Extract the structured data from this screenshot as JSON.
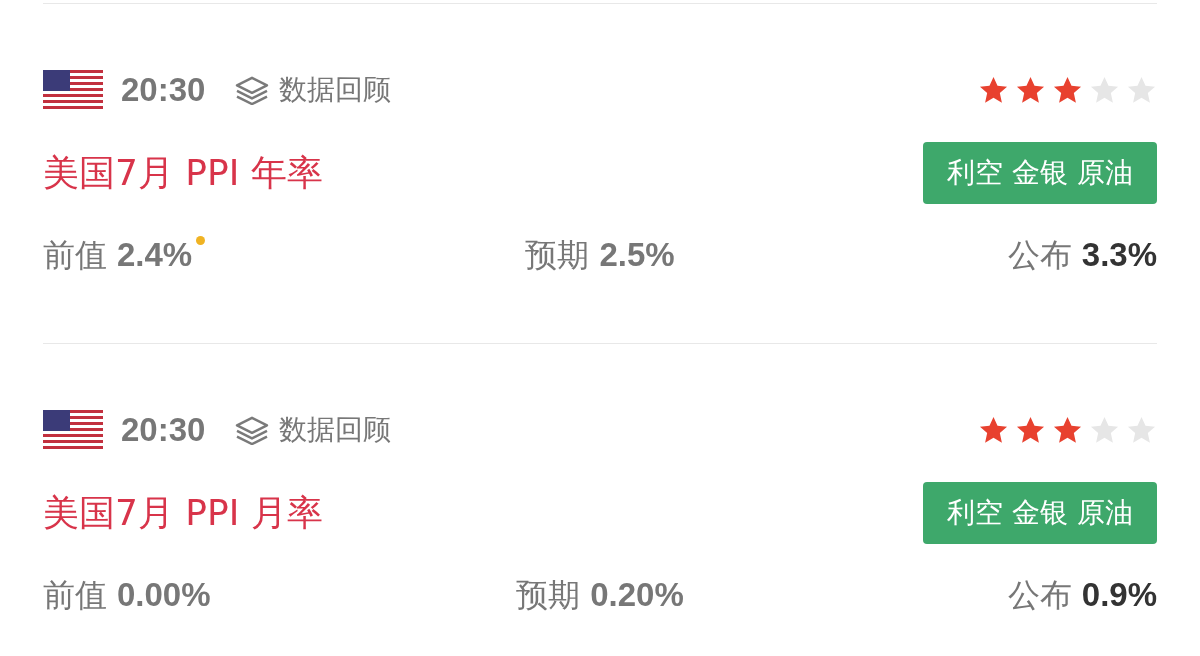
{
  "events": [
    {
      "time": "20:30",
      "source": "数据回顾",
      "stars": 3,
      "title": "美国7月 PPI 年率",
      "impact": "利空 金银 原油",
      "previous": {
        "label": "前值",
        "value": "2.4%",
        "revised": true
      },
      "forecast": {
        "label": "预期",
        "value": "2.5%"
      },
      "actual": {
        "label": "公布",
        "value": "3.3%"
      }
    },
    {
      "time": "20:30",
      "source": "数据回顾",
      "stars": 3,
      "title": "美国7月 PPI 月率",
      "impact": "利空 金银 原油",
      "previous": {
        "label": "前值",
        "value": "0.00%",
        "revised": false
      },
      "forecast": {
        "label": "预期",
        "value": "0.20%"
      },
      "actual": {
        "label": "公布",
        "value": "0.9%"
      }
    }
  ]
}
